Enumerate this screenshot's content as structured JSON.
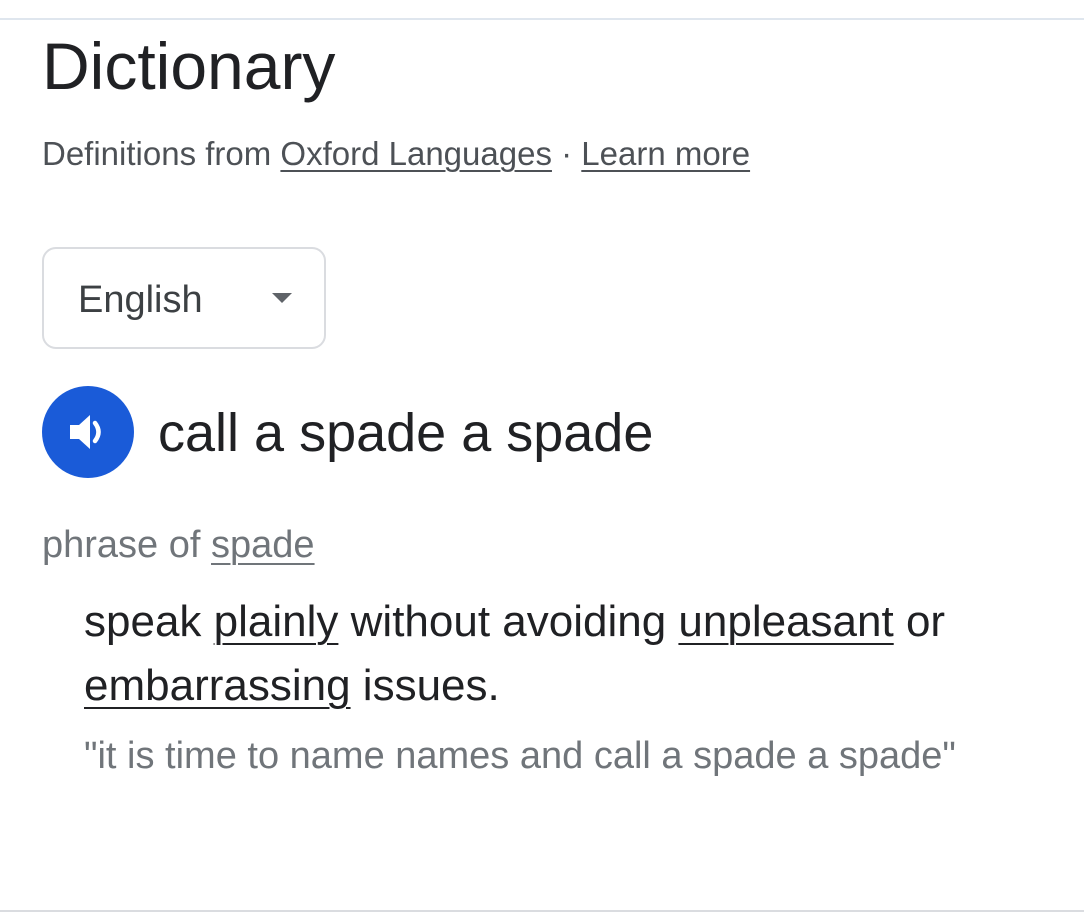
{
  "header": {
    "title": "Dictionary",
    "source_prefix": "Definitions from",
    "source_link": "Oxford Languages",
    "separator": "·",
    "learn_more": "Learn more"
  },
  "language_select": {
    "value": "English",
    "icon": "chevron-down-icon"
  },
  "entry": {
    "audio_icon": "speaker-icon",
    "audio_color": "#1a5bd8",
    "headword": "call a spade a spade",
    "pos_prefix": "phrase of",
    "pos_link": "spade",
    "definition": {
      "w1": "speak",
      "link1": "plainly",
      "w2": "without avoiding",
      "link2": "unpleasant",
      "w3": "or",
      "link3": "embarrassing",
      "w4": "issues."
    },
    "example": "\"it is time to name names and call a spade a spade\""
  }
}
